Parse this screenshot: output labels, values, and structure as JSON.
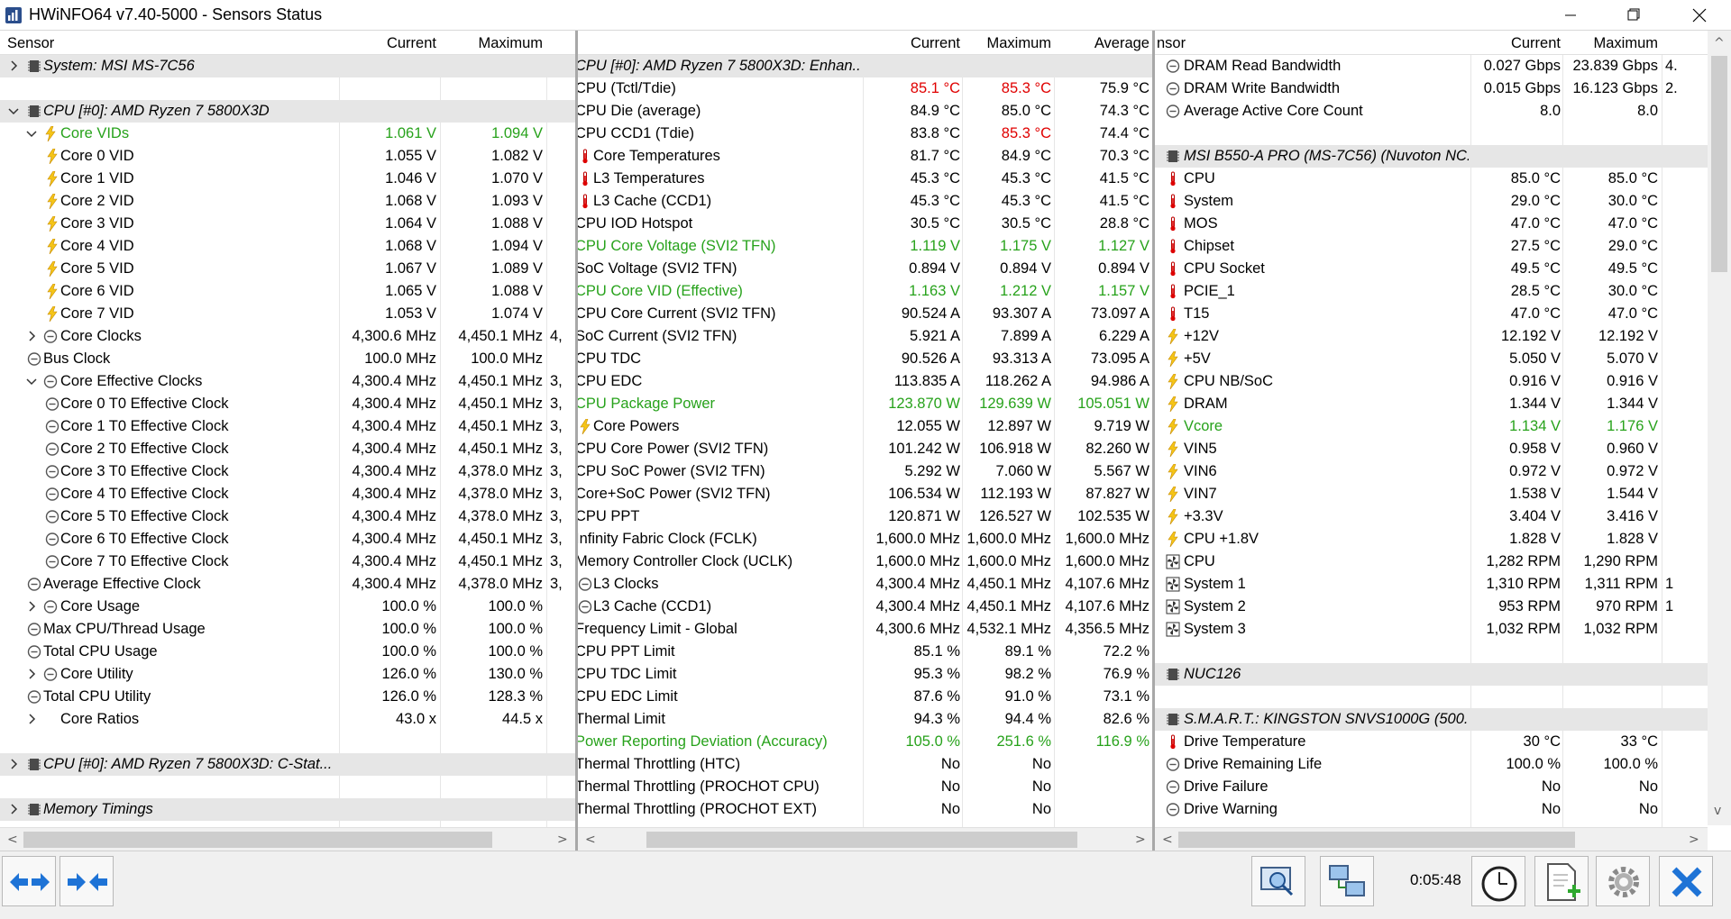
{
  "window": {
    "title": "HWiNFO64 v7.40-5000 - Sensors Status"
  },
  "left": {
    "headers": {
      "sensor": "Sensor",
      "current": "Current",
      "maximum": "Maximum"
    },
    "overflow_chars": [
      "",
      "",
      "",
      "",
      "",
      "",
      "",
      "",
      "",
      "",
      "",
      "",
      "4,",
      "",
      "3,",
      "3,",
      "3,",
      "3,",
      "3,",
      "3,",
      "3,",
      "3,",
      "3,",
      "3,",
      "",
      "",
      "",
      "",
      "",
      "",
      "",
      "",
      "",
      "",
      "",
      ""
    ],
    "rows": [
      {
        "label": "System: MSI MS-7C56",
        "group": true,
        "icon": "chip",
        "expand": ">",
        "indent": 0,
        "current": "",
        "max": ""
      },
      {
        "label": "",
        "group": false,
        "icon": "",
        "expand": "",
        "indent": 0,
        "current": "",
        "max": ""
      },
      {
        "label": "CPU [#0]: AMD Ryzen 7 5800X3D",
        "group": true,
        "icon": "chip",
        "expand": "v",
        "indent": 0,
        "current": "",
        "max": ""
      },
      {
        "label": "Core VIDs",
        "color": "green",
        "icon": "bolt",
        "expand": "v",
        "indent": 1,
        "current": "1.061 V",
        "max": "1.094 V"
      },
      {
        "label": "Core 0 VID",
        "icon": "bolt",
        "expand": "",
        "indent": 2,
        "current": "1.055 V",
        "max": "1.082 V"
      },
      {
        "label": "Core 1 VID",
        "icon": "bolt",
        "expand": "",
        "indent": 2,
        "current": "1.046 V",
        "max": "1.070 V"
      },
      {
        "label": "Core 2 VID",
        "icon": "bolt",
        "expand": "",
        "indent": 2,
        "current": "1.068 V",
        "max": "1.093 V"
      },
      {
        "label": "Core 3 VID",
        "icon": "bolt",
        "expand": "",
        "indent": 2,
        "current": "1.064 V",
        "max": "1.088 V"
      },
      {
        "label": "Core 4 VID",
        "icon": "bolt",
        "expand": "",
        "indent": 2,
        "current": "1.068 V",
        "max": "1.094 V"
      },
      {
        "label": "Core 5 VID",
        "icon": "bolt",
        "expand": "",
        "indent": 2,
        "current": "1.067 V",
        "max": "1.089 V"
      },
      {
        "label": "Core 6 VID",
        "icon": "bolt",
        "expand": "",
        "indent": 2,
        "current": "1.065 V",
        "max": "1.088 V"
      },
      {
        "label": "Core 7 VID",
        "icon": "bolt",
        "expand": "",
        "indent": 2,
        "current": "1.053 V",
        "max": "1.074 V"
      },
      {
        "label": "Core Clocks",
        "icon": "clock",
        "expand": ">",
        "indent": 1,
        "current": "4,300.6 MHz",
        "max": "4,450.1 MHz"
      },
      {
        "label": "Bus Clock",
        "icon": "clock",
        "expand": "",
        "indent": 0,
        "current": "100.0 MHz",
        "max": "100.0 MHz"
      },
      {
        "label": "Core Effective Clocks",
        "icon": "clock",
        "expand": "v",
        "indent": 1,
        "current": "4,300.4 MHz",
        "max": "4,450.1 MHz"
      },
      {
        "label": "Core 0 T0 Effective Clock",
        "icon": "clock",
        "expand": "",
        "indent": 2,
        "current": "4,300.4 MHz",
        "max": "4,450.1 MHz"
      },
      {
        "label": "Core 1 T0 Effective Clock",
        "icon": "clock",
        "expand": "",
        "indent": 2,
        "current": "4,300.4 MHz",
        "max": "4,450.1 MHz"
      },
      {
        "label": "Core 2 T0 Effective Clock",
        "icon": "clock",
        "expand": "",
        "indent": 2,
        "current": "4,300.4 MHz",
        "max": "4,450.1 MHz"
      },
      {
        "label": "Core 3 T0 Effective Clock",
        "icon": "clock",
        "expand": "",
        "indent": 2,
        "current": "4,300.4 MHz",
        "max": "4,378.0 MHz"
      },
      {
        "label": "Core 4 T0 Effective Clock",
        "icon": "clock",
        "expand": "",
        "indent": 2,
        "current": "4,300.4 MHz",
        "max": "4,378.0 MHz"
      },
      {
        "label": "Core 5 T0 Effective Clock",
        "icon": "clock",
        "expand": "",
        "indent": 2,
        "current": "4,300.4 MHz",
        "max": "4,378.0 MHz"
      },
      {
        "label": "Core 6 T0 Effective Clock",
        "icon": "clock",
        "expand": "",
        "indent": 2,
        "current": "4,300.4 MHz",
        "max": "4,450.1 MHz"
      },
      {
        "label": "Core 7 T0 Effective Clock",
        "icon": "clock",
        "expand": "",
        "indent": 2,
        "current": "4,300.4 MHz",
        "max": "4,450.1 MHz"
      },
      {
        "label": "Average Effective Clock",
        "icon": "clock",
        "expand": "",
        "indent": 0,
        "current": "4,300.4 MHz",
        "max": "4,378.0 MHz"
      },
      {
        "label": "Core Usage",
        "icon": "clock",
        "expand": ">",
        "indent": 1,
        "current": "100.0 %",
        "max": "100.0 %"
      },
      {
        "label": "Max CPU/Thread Usage",
        "icon": "clock",
        "expand": "",
        "indent": 0,
        "current": "100.0 %",
        "max": "100.0 %"
      },
      {
        "label": "Total CPU Usage",
        "icon": "clock",
        "expand": "",
        "indent": 0,
        "current": "100.0 %",
        "max": "100.0 %"
      },
      {
        "label": "Core Utility",
        "icon": "clock",
        "expand": ">",
        "indent": 1,
        "current": "126.0 %",
        "max": "130.0 %"
      },
      {
        "label": "Total CPU Utility",
        "icon": "clock",
        "expand": "",
        "indent": 0,
        "current": "126.0 %",
        "max": "128.3 %"
      },
      {
        "label": "Core Ratios",
        "icon": "",
        "expand": ">",
        "indent": 1,
        "current": "43.0 x",
        "max": "44.5 x"
      },
      {
        "label": "",
        "icon": "",
        "expand": "",
        "indent": 0,
        "current": "",
        "max": ""
      },
      {
        "label": "CPU [#0]: AMD Ryzen 7 5800X3D: C-Stat...",
        "group": true,
        "icon": "chip",
        "expand": ">",
        "indent": 0,
        "current": "",
        "max": ""
      },
      {
        "label": "",
        "icon": "",
        "expand": "",
        "indent": 0,
        "current": "",
        "max": ""
      },
      {
        "label": "Memory Timings",
        "group": true,
        "icon": "chip",
        "expand": ">",
        "indent": 0,
        "current": "",
        "max": ""
      }
    ]
  },
  "middle": {
    "headers": {
      "current": "Current",
      "maximum": "Maximum",
      "average": "Average"
    },
    "rows": [
      {
        "label": "CPU [#0]: AMD Ryzen 7 5800X3D: Enhan...",
        "group": true,
        "icon": "",
        "current": "",
        "max": "",
        "avg": ""
      },
      {
        "label": "CPU (Tctl/Tdie)",
        "icon": "",
        "current": "85.1 °C",
        "max": "85.3 °C",
        "avg": "75.9 °C",
        "cur_color": "red",
        "max_color": "red"
      },
      {
        "label": "CPU Die (average)",
        "icon": "",
        "current": "84.9 °C",
        "max": "85.0 °C",
        "avg": "74.3 °C"
      },
      {
        "label": "CPU CCD1 (Tdie)",
        "icon": "",
        "current": "83.8 °C",
        "max": "85.3 °C",
        "avg": "74.4 °C",
        "max_color": "red"
      },
      {
        "label": "Core Temperatures",
        "icon": "therm",
        "current": "81.7 °C",
        "max": "84.9 °C",
        "avg": "70.3 °C"
      },
      {
        "label": "L3 Temperatures",
        "icon": "therm",
        "current": "45.3 °C",
        "max": "45.3 °C",
        "avg": "41.5 °C"
      },
      {
        "label": "L3 Cache (CCD1)",
        "icon": "therm",
        "current": "45.3 °C",
        "max": "45.3 °C",
        "avg": "41.5 °C"
      },
      {
        "label": "CPU IOD Hotspot",
        "icon": "",
        "current": "30.5 °C",
        "max": "30.5 °C",
        "avg": "28.8 °C"
      },
      {
        "label": "CPU Core Voltage (SVI2 TFN)",
        "color": "green",
        "icon": "",
        "current": "1.119 V",
        "max": "1.175 V",
        "avg": "1.127 V",
        "cur_color": "green",
        "max_color": "green",
        "avg_color": "green"
      },
      {
        "label": "SoC Voltage (SVI2 TFN)",
        "icon": "",
        "current": "0.894 V",
        "max": "0.894 V",
        "avg": "0.894 V"
      },
      {
        "label": "CPU Core VID (Effective)",
        "color": "green",
        "icon": "",
        "current": "1.163 V",
        "max": "1.212 V",
        "avg": "1.157 V",
        "cur_color": "green",
        "max_color": "green",
        "avg_color": "green"
      },
      {
        "label": "CPU Core Current (SVI2 TFN)",
        "icon": "",
        "current": "90.524 A",
        "max": "93.307 A",
        "avg": "73.097 A"
      },
      {
        "label": "SoC Current (SVI2 TFN)",
        "icon": "",
        "current": "5.921 A",
        "max": "7.899 A",
        "avg": "6.229 A"
      },
      {
        "label": "CPU TDC",
        "icon": "",
        "current": "90.526 A",
        "max": "93.313 A",
        "avg": "73.095 A"
      },
      {
        "label": "CPU EDC",
        "icon": "",
        "current": "113.835 A",
        "max": "118.262 A",
        "avg": "94.986 A"
      },
      {
        "label": "CPU Package Power",
        "color": "green",
        "icon": "",
        "current": "123.870 W",
        "max": "129.639 W",
        "avg": "105.051 W",
        "cur_color": "green",
        "max_color": "green",
        "avg_color": "green"
      },
      {
        "label": "Core Powers",
        "icon": "bolt",
        "current": "12.055 W",
        "max": "12.897 W",
        "avg": "9.719 W"
      },
      {
        "label": "CPU Core Power (SVI2 TFN)",
        "icon": "",
        "current": "101.242 W",
        "max": "106.918 W",
        "avg": "82.260 W"
      },
      {
        "label": "CPU SoC Power (SVI2 TFN)",
        "icon": "",
        "current": "5.292 W",
        "max": "7.060 W",
        "avg": "5.567 W"
      },
      {
        "label": "Core+SoC Power (SVI2 TFN)",
        "icon": "",
        "current": "106.534 W",
        "max": "112.193 W",
        "avg": "87.827 W"
      },
      {
        "label": "CPU PPT",
        "icon": "",
        "current": "120.871 W",
        "max": "126.527 W",
        "avg": "102.535 W"
      },
      {
        "label": "Infinity Fabric Clock (FCLK)",
        "icon": "",
        "current": "1,600.0 MHz",
        "max": "1,600.0 MHz",
        "avg": "1,600.0 MHz"
      },
      {
        "label": "Memory Controller Clock (UCLK)",
        "icon": "",
        "current": "1,600.0 MHz",
        "max": "1,600.0 MHz",
        "avg": "1,600.0 MHz"
      },
      {
        "label": "L3 Clocks",
        "icon": "clock",
        "current": "4,300.4 MHz",
        "max": "4,450.1 MHz",
        "avg": "4,107.6 MHz"
      },
      {
        "label": "L3 Cache (CCD1)",
        "icon": "clock",
        "current": "4,300.4 MHz",
        "max": "4,450.1 MHz",
        "avg": "4,107.6 MHz"
      },
      {
        "label": "Frequency Limit - Global",
        "icon": "",
        "current": "4,300.6 MHz",
        "max": "4,532.1 MHz",
        "avg": "4,356.5 MHz"
      },
      {
        "label": "CPU PPT Limit",
        "icon": "",
        "current": "85.1 %",
        "max": "89.1 %",
        "avg": "72.2 %"
      },
      {
        "label": "CPU TDC Limit",
        "icon": "",
        "current": "95.3 %",
        "max": "98.2 %",
        "avg": "76.9 %"
      },
      {
        "label": "CPU EDC Limit",
        "icon": "",
        "current": "87.6 %",
        "max": "91.0 %",
        "avg": "73.1 %"
      },
      {
        "label": "Thermal Limit",
        "icon": "",
        "current": "94.3 %",
        "max": "94.4 %",
        "avg": "82.6 %"
      },
      {
        "label": "Power Reporting Deviation (Accuracy)",
        "color": "green",
        "icon": "",
        "current": "105.0 %",
        "max": "251.6 %",
        "avg": "116.9 %",
        "cur_color": "green",
        "max_color": "green",
        "avg_color": "green"
      },
      {
        "label": "Thermal Throttling (HTC)",
        "icon": "",
        "current": "No",
        "max": "No",
        "avg": ""
      },
      {
        "label": "Thermal Throttling (PROCHOT CPU)",
        "icon": "",
        "current": "No",
        "max": "No",
        "avg": ""
      },
      {
        "label": "Thermal Throttling (PROCHOT EXT)",
        "icon": "",
        "current": "No",
        "max": "No",
        "avg": ""
      }
    ]
  },
  "right": {
    "headers": {
      "sensor": "nsor",
      "current": "Current",
      "maximum": "Maximum"
    },
    "overflow_chars": [
      "4.",
      "2.",
      "",
      "",
      "",
      "",
      "",
      "",
      "",
      "",
      "",
      "",
      "",
      "",
      "",
      "",
      "",
      "",
      "",
      "",
      "",
      "",
      "",
      "1",
      "1",
      "",
      "",
      "",
      "",
      "",
      "",
      "",
      "",
      ""
    ],
    "rows": [
      {
        "label": "DRAM Read Bandwidth",
        "icon": "clock",
        "current": "0.027 Gbps",
        "max": "23.839 Gbps"
      },
      {
        "label": "DRAM Write Bandwidth",
        "icon": "clock",
        "current": "0.015 Gbps",
        "max": "16.123 Gbps"
      },
      {
        "label": "Average Active Core Count",
        "icon": "clock",
        "current": "8.0",
        "max": "8.0"
      },
      {
        "label": "",
        "icon": "",
        "current": "",
        "max": ""
      },
      {
        "label": "MSI B550-A PRO (MS-7C56) (Nuvoton NC...",
        "group": true,
        "icon": "chip",
        "current": "",
        "max": ""
      },
      {
        "label": "CPU",
        "icon": "therm",
        "current": "85.0 °C",
        "max": "85.0 °C"
      },
      {
        "label": "System",
        "icon": "therm",
        "current": "29.0 °C",
        "max": "30.0 °C"
      },
      {
        "label": "MOS",
        "icon": "therm",
        "current": "47.0 °C",
        "max": "47.0 °C"
      },
      {
        "label": "Chipset",
        "icon": "therm",
        "current": "27.5 °C",
        "max": "29.0 °C"
      },
      {
        "label": "CPU Socket",
        "icon": "therm",
        "current": "49.5 °C",
        "max": "49.5 °C"
      },
      {
        "label": "PCIE_1",
        "icon": "therm",
        "current": "28.5 °C",
        "max": "30.0 °C"
      },
      {
        "label": "T15",
        "icon": "therm",
        "current": "47.0 °C",
        "max": "47.0 °C"
      },
      {
        "label": "+12V",
        "icon": "bolt",
        "current": "12.192 V",
        "max": "12.192 V"
      },
      {
        "label": "+5V",
        "icon": "bolt",
        "current": "5.050 V",
        "max": "5.070 V"
      },
      {
        "label": "CPU NB/SoC",
        "icon": "bolt",
        "current": "0.916 V",
        "max": "0.916 V"
      },
      {
        "label": "DRAM",
        "icon": "bolt",
        "current": "1.344 V",
        "max": "1.344 V"
      },
      {
        "label": "Vcore",
        "color": "green",
        "icon": "bolt",
        "current": "1.134 V",
        "max": "1.176 V",
        "cur_color": "green",
        "max_color": "green"
      },
      {
        "label": "VIN5",
        "icon": "bolt",
        "current": "0.958 V",
        "max": "0.960 V"
      },
      {
        "label": "VIN6",
        "icon": "bolt",
        "current": "0.972 V",
        "max": "0.972 V"
      },
      {
        "label": "VIN7",
        "icon": "bolt",
        "current": "1.538 V",
        "max": "1.544 V"
      },
      {
        "label": "+3.3V",
        "icon": "bolt",
        "current": "3.404 V",
        "max": "3.416 V"
      },
      {
        "label": "CPU +1.8V",
        "icon": "bolt",
        "current": "1.828 V",
        "max": "1.828 V"
      },
      {
        "label": "CPU",
        "icon": "fan",
        "current": "1,282 RPM",
        "max": "1,290 RPM"
      },
      {
        "label": "System 1",
        "icon": "fan",
        "current": "1,310 RPM",
        "max": "1,311 RPM"
      },
      {
        "label": "System 2",
        "icon": "fan",
        "current": "953 RPM",
        "max": "970 RPM"
      },
      {
        "label": "System 3",
        "icon": "fan",
        "current": "1,032 RPM",
        "max": "1,032 RPM"
      },
      {
        "label": "",
        "icon": "",
        "current": "",
        "max": ""
      },
      {
        "label": "NUC126",
        "group": true,
        "icon": "chip",
        "current": "",
        "max": ""
      },
      {
        "label": "",
        "icon": "",
        "current": "",
        "max": ""
      },
      {
        "label": "S.M.A.R.T.: KINGSTON SNVS1000G (500...",
        "group": true,
        "icon": "chip",
        "current": "",
        "max": ""
      },
      {
        "label": "Drive Temperature",
        "icon": "therm",
        "current": "30 °C",
        "max": "33 °C"
      },
      {
        "label": "Drive Remaining Life",
        "icon": "clock",
        "current": "100.0 %",
        "max": "100.0 %"
      },
      {
        "label": "Drive Failure",
        "icon": "clock",
        "current": "No",
        "max": "No"
      },
      {
        "label": "Drive Warning",
        "icon": "clock",
        "current": "No",
        "max": "No"
      }
    ]
  },
  "footer": {
    "elapsed_time": "0:05:48"
  }
}
